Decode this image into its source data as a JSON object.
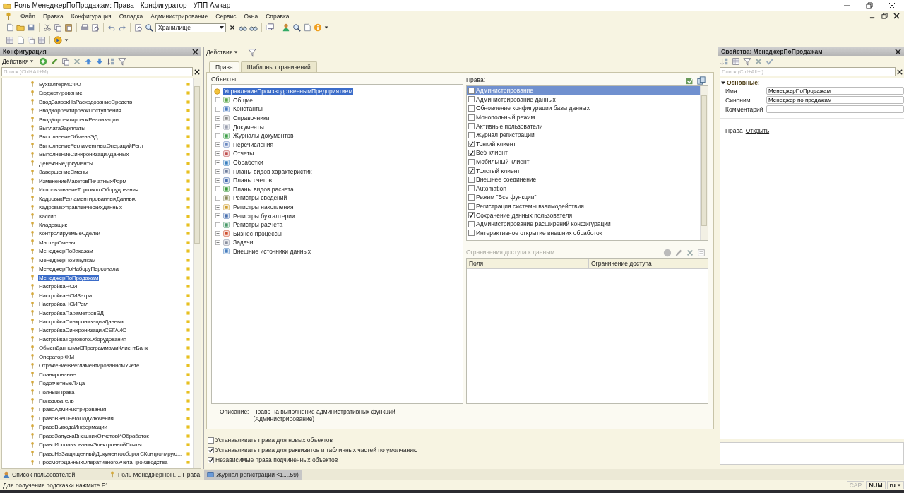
{
  "window": {
    "title": "Роль МенеджерПоПродажам: Права - Конфигуратор - УПП Амкар"
  },
  "menu": [
    "Файл",
    "Правка",
    "Конфигурация",
    "Отладка",
    "Администрирование",
    "Сервис",
    "Окна",
    "Справка"
  ],
  "toolbar": {
    "storage_combo": {
      "value": "Хранилище"
    }
  },
  "config_panel": {
    "title": "Конфигурация",
    "actions": "Действия",
    "search": {
      "placeholder": "Поиск (Ctrl+Alt+M)"
    },
    "items": [
      {
        "label": "БухгалтерМСФО",
        "selected": false
      },
      {
        "label": "Бюджетирование",
        "selected": false
      },
      {
        "label": "ВводЗаявокНаРасходованиеСредств",
        "selected": false
      },
      {
        "label": "ВводКорректировокПоступления",
        "selected": false
      },
      {
        "label": "ВводКорректировокРеализации",
        "selected": false
      },
      {
        "label": "ВыплатаЗарплаты",
        "selected": false
      },
      {
        "label": "ВыполнениеОбменаЭД",
        "selected": false
      },
      {
        "label": "ВыполнениеРегламентныхОперацийРегл",
        "selected": false
      },
      {
        "label": "ВыполнениеСинхронизацииДанных",
        "selected": false
      },
      {
        "label": "ДенежныеДокументы",
        "selected": false
      },
      {
        "label": "ЗавершениеСмены",
        "selected": false
      },
      {
        "label": "ИзменениеМакетовПечатныхФорм",
        "selected": false
      },
      {
        "label": "ИспользованиеТорговогоОборудования",
        "selected": false
      },
      {
        "label": "КадровикРегламентированныхДанных",
        "selected": false
      },
      {
        "label": "КадровикУправленческихДанных",
        "selected": false
      },
      {
        "label": "Кассир",
        "selected": false
      },
      {
        "label": "Кладовщик",
        "selected": false
      },
      {
        "label": "КонтролируемыеСделки",
        "selected": false
      },
      {
        "label": "МастерСмены",
        "selected": false
      },
      {
        "label": "МенеджерПоЗаказам",
        "selected": false
      },
      {
        "label": "МенеджерПоЗакупкам",
        "selected": false
      },
      {
        "label": "МенеджерПоНаборуПерсонала",
        "selected": false
      },
      {
        "label": "МенеджерПоПродажам",
        "selected": true
      },
      {
        "label": "НастройкаНСИ",
        "selected": false
      },
      {
        "label": "НастройкаНСИЗатрат",
        "selected": false
      },
      {
        "label": "НастройкаНСИРегл",
        "selected": false
      },
      {
        "label": "НастройкаПараметровЭД",
        "selected": false
      },
      {
        "label": "НастройкаСинхронизацииДанных",
        "selected": false
      },
      {
        "label": "НастройкаСинхронизацииСЕГАИС",
        "selected": false
      },
      {
        "label": "НастройкаТорговогоОборудования",
        "selected": false
      },
      {
        "label": "ОбменДаннымиСПрограммамиКлиентБанк",
        "selected": false
      },
      {
        "label": "ОператорККМ",
        "selected": false
      },
      {
        "label": "ОтражениеВРегламентированномУчете",
        "selected": false
      },
      {
        "label": "Планирование",
        "selected": false
      },
      {
        "label": "ПодотчетныеЛица",
        "selected": false
      },
      {
        "label": "ПолныеПрава",
        "selected": false
      },
      {
        "label": "Пользователь",
        "selected": false
      },
      {
        "label": "ПравоАдминистрирования",
        "selected": false
      },
      {
        "label": "ПравоВнешнегоПодключения",
        "selected": false
      },
      {
        "label": "ПравоВыводаИнформации",
        "selected": false
      },
      {
        "label": "ПравоЗапускаВнешнихОтчетовИОбработок",
        "selected": false
      },
      {
        "label": "ПравоИспользованияЭлектроннойПочты",
        "selected": false
      },
      {
        "label": "ПравоНаЗащищенныйДокументооборотСКонтролирую...",
        "selected": false
      },
      {
        "label": "ПросмотрДанныхОперативногоУчетаПроизводства",
        "selected": false
      }
    ]
  },
  "editor": {
    "actions": "Действия",
    "tabs": [
      {
        "label": "Права",
        "selected": true
      },
      {
        "label": "Шаблоны ограничений",
        "selected": false
      }
    ],
    "objects_label": "Объекты:",
    "objects": [
      {
        "label": "УправлениеПроизводственнымПредприятием",
        "selected": true,
        "children": [
          {
            "label": "Общие",
            "expandable": true
          },
          {
            "label": "Константы",
            "expandable": true
          },
          {
            "label": "Справочники",
            "expandable": true
          },
          {
            "label": "Документы",
            "expandable": true
          },
          {
            "label": "Журналы документов",
            "expandable": true
          },
          {
            "label": "Перечисления",
            "expandable": true
          },
          {
            "label": "Отчеты",
            "expandable": true
          },
          {
            "label": "Обработки",
            "expandable": true
          },
          {
            "label": "Планы видов характеристик",
            "expandable": true
          },
          {
            "label": "Планы счетов",
            "expandable": true
          },
          {
            "label": "Планы видов расчета",
            "expandable": true
          },
          {
            "label": "Регистры сведений",
            "expandable": true
          },
          {
            "label": "Регистры накопления",
            "expandable": true
          },
          {
            "label": "Регистры бухгалтерии",
            "expandable": true
          },
          {
            "label": "Регистры расчета",
            "expandable": true
          },
          {
            "label": "Бизнес-процессы",
            "expandable": true
          },
          {
            "label": "Задачи",
            "expandable": true
          },
          {
            "label": "Внешние источники данных",
            "expandable": false
          }
        ]
      }
    ],
    "rights_label": "Права:",
    "rights": [
      {
        "label": "Администрирование",
        "checked": false,
        "selected": true
      },
      {
        "label": "Администрирование данных",
        "checked": false,
        "selected": false
      },
      {
        "label": "Обновление конфигурации базы данных",
        "checked": false,
        "selected": false
      },
      {
        "label": "Монопольный режим",
        "checked": false,
        "selected": false
      },
      {
        "label": "Активные пользователи",
        "checked": false,
        "selected": false
      },
      {
        "label": "Журнал регистрации",
        "checked": false,
        "selected": false
      },
      {
        "label": "Тонкий клиент",
        "checked": true,
        "selected": false
      },
      {
        "label": "Веб-клиент",
        "checked": true,
        "selected": false
      },
      {
        "label": "Мобильный клиент",
        "checked": false,
        "selected": false
      },
      {
        "label": "Толстый клиент",
        "checked": true,
        "selected": false
      },
      {
        "label": "Внешнее соединение",
        "checked": false,
        "selected": false
      },
      {
        "label": "Automation",
        "checked": false,
        "selected": false
      },
      {
        "label": "Режим \"Все функции\"",
        "checked": false,
        "selected": false
      },
      {
        "label": "Регистрация системы взаимодействия",
        "checked": false,
        "selected": false
      },
      {
        "label": "Сохранение данных пользователя",
        "checked": true,
        "selected": false
      },
      {
        "label": "Администрирование расширений конфигурации",
        "checked": false,
        "selected": false
      },
      {
        "label": "Интерактивное открытие внешних обработок",
        "checked": false,
        "selected": false
      }
    ],
    "restrictions": {
      "label": "Ограничения доступа к данным:",
      "columns": [
        "Поля",
        "Ограничение доступа"
      ]
    },
    "description": {
      "label": "Описание:",
      "lines": [
        "Право на выполнение административных функций",
        "(Администрирование)"
      ]
    },
    "options": [
      {
        "label": "Устанавливать права для новых объектов",
        "checked": false
      },
      {
        "label": "Устанавливать права для реквизитов и табличных частей по умолчанию",
        "checked": true
      },
      {
        "label": "Независимые права подчиненных объектов",
        "checked": true
      }
    ]
  },
  "properties": {
    "title": "Свойства: МенеджерПоПродажам",
    "search": {
      "placeholder": "Поиск (Ctrl+Alt+I)"
    },
    "group": "Основные:",
    "fields": [
      {
        "label": "Имя",
        "value": "МенеджерПоПродажам"
      },
      {
        "label": "Синоним",
        "value": "Менеджер по продажам"
      },
      {
        "label": "Комментарий"
      }
    ],
    "link_row": {
      "label": "Права",
      "link": "Открыть"
    }
  },
  "window_tabs": [
    {
      "label": "Список пользователей",
      "selected": false
    },
    {
      "label": "Роль МенеджерПоП.... Права",
      "selected": false
    },
    {
      "label": "Журнал регистрации <1....59)",
      "selected": true
    }
  ],
  "status_bar": {
    "hint": "Для получения подсказки нажмите F1",
    "indicators": [
      {
        "label": "CAP",
        "on": false
      },
      {
        "label": "NUM",
        "on": true
      },
      {
        "label": "ru",
        "on": true
      }
    ]
  }
}
